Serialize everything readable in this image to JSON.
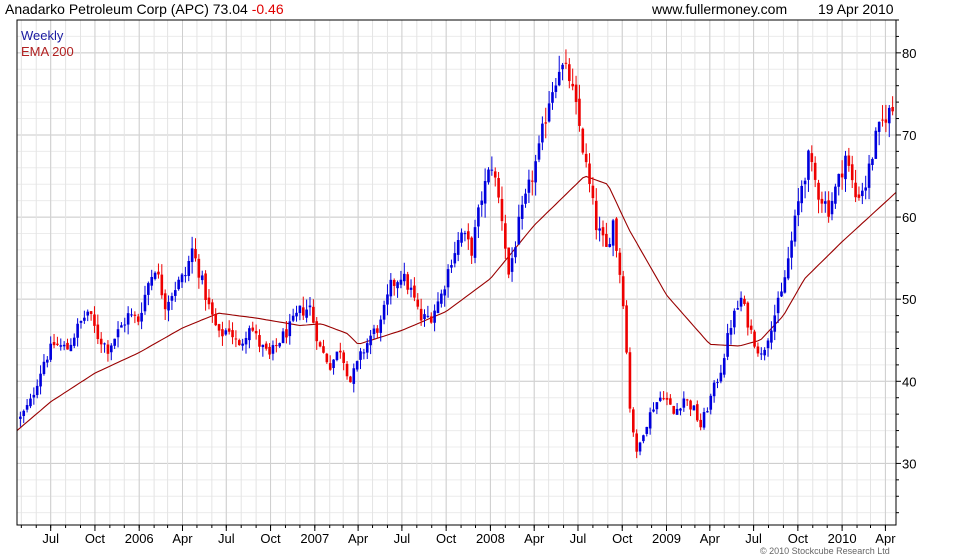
{
  "header": {
    "title": "Anadarko Petroleum Corp (APC)",
    "price": "73.04",
    "change": "-0.46",
    "site": "www.fullermoney.com",
    "date": "19 Apr 2010"
  },
  "footer": {
    "copyright": "© 2010 Stockcube Research Ltd"
  },
  "colors": {
    "up": "#0000dd",
    "down": "#ee0000",
    "ema": "#990000",
    "grid": "#d8d8d8",
    "axis": "#000000"
  },
  "chart_data": {
    "type": "candlestick",
    "legend": [
      {
        "label": "Weekly",
        "color": "#1a1aa0"
      },
      {
        "label": "EMA 200",
        "color": "#b02020"
      }
    ],
    "legend_position": "top-left",
    "grid": true,
    "y_axis_side": "right",
    "ylim": [
      22.5,
      84
    ],
    "yticks": [
      30,
      40,
      50,
      60,
      70,
      80
    ],
    "x_start": "2005-04-22",
    "x_end": "2010-04-23",
    "xticks": [
      {
        "label": "Jul",
        "date": "2005-07-01"
      },
      {
        "label": "Oct",
        "date": "2005-10-01"
      },
      {
        "label": "2006",
        "date": "2006-01-01"
      },
      {
        "label": "Apr",
        "date": "2006-04-01"
      },
      {
        "label": "Jul",
        "date": "2006-07-01"
      },
      {
        "label": "Oct",
        "date": "2006-10-01"
      },
      {
        "label": "2007",
        "date": "2007-01-01"
      },
      {
        "label": "Apr",
        "date": "2007-04-01"
      },
      {
        "label": "Jul",
        "date": "2007-07-01"
      },
      {
        "label": "Oct",
        "date": "2007-10-01"
      },
      {
        "label": "2008",
        "date": "2008-01-01"
      },
      {
        "label": "Apr",
        "date": "2008-04-01"
      },
      {
        "label": "Jul",
        "date": "2008-07-01"
      },
      {
        "label": "Oct",
        "date": "2008-10-01"
      },
      {
        "label": "2009",
        "date": "2009-01-01"
      },
      {
        "label": "Apr",
        "date": "2009-04-01"
      },
      {
        "label": "Jul",
        "date": "2009-07-01"
      },
      {
        "label": "Oct",
        "date": "2009-10-01"
      },
      {
        "label": "2010",
        "date": "2010-01-01"
      },
      {
        "label": "Apr",
        "date": "2010-04-01"
      }
    ],
    "close_anchors": [
      [
        "2005-04-29",
        35.5
      ],
      [
        "2005-05-20",
        37.5
      ],
      [
        "2005-06-17",
        42.5
      ],
      [
        "2005-07-08",
        44.5
      ],
      [
        "2005-08-05",
        44.0
      ],
      [
        "2005-08-26",
        46.5
      ],
      [
        "2005-09-16",
        48.5
      ],
      [
        "2005-10-07",
        45.5
      ],
      [
        "2005-10-28",
        44.0
      ],
      [
        "2005-11-18",
        46.0
      ],
      [
        "2005-12-09",
        48.0
      ],
      [
        "2005-12-30",
        47.5
      ],
      [
        "2006-01-20",
        52.0
      ],
      [
        "2006-02-03",
        54.0
      ],
      [
        "2006-02-24",
        49.5
      ],
      [
        "2006-03-17",
        51.5
      ],
      [
        "2006-04-07",
        53.0
      ],
      [
        "2006-04-21",
        56.0
      ],
      [
        "2006-05-05",
        53.5
      ],
      [
        "2006-05-26",
        49.0
      ],
      [
        "2006-06-16",
        45.5
      ],
      [
        "2006-07-07",
        46.5
      ],
      [
        "2006-07-28",
        44.0
      ],
      [
        "2006-08-18",
        47.0
      ],
      [
        "2006-09-08",
        44.5
      ],
      [
        "2006-09-29",
        43.0
      ],
      [
        "2006-10-20",
        45.0
      ],
      [
        "2006-11-10",
        46.5
      ],
      [
        "2006-12-01",
        48.5
      ],
      [
        "2006-12-22",
        49.0
      ],
      [
        "2007-01-12",
        44.0
      ],
      [
        "2007-02-02",
        42.0
      ],
      [
        "2007-02-23",
        44.0
      ],
      [
        "2007-03-16",
        40.0
      ],
      [
        "2007-04-06",
        43.0
      ],
      [
        "2007-04-27",
        45.5
      ],
      [
        "2007-05-18",
        47.0
      ],
      [
        "2007-06-08",
        51.5
      ],
      [
        "2007-06-29",
        53.0
      ],
      [
        "2007-07-20",
        51.0
      ],
      [
        "2007-08-10",
        47.5
      ],
      [
        "2007-08-31",
        48.0
      ],
      [
        "2007-09-21",
        50.5
      ],
      [
        "2007-10-12",
        55.0
      ],
      [
        "2007-11-02",
        58.0
      ],
      [
        "2007-11-23",
        56.0
      ],
      [
        "2007-12-14",
        62.5
      ],
      [
        "2008-01-04",
        66.5
      ],
      [
        "2008-01-25",
        60.0
      ],
      [
        "2008-02-08",
        53.0
      ],
      [
        "2008-02-29",
        59.0
      ],
      [
        "2008-03-21",
        63.5
      ],
      [
        "2008-04-11",
        68.0
      ],
      [
        "2008-05-02",
        74.5
      ],
      [
        "2008-05-23",
        78.5
      ],
      [
        "2008-06-13",
        77.0
      ],
      [
        "2008-07-04",
        71.0
      ],
      [
        "2008-07-18",
        66.0
      ],
      [
        "2008-08-08",
        59.0
      ],
      [
        "2008-08-29",
        56.0
      ],
      [
        "2008-09-12",
        59.5
      ],
      [
        "2008-10-03",
        50.0
      ],
      [
        "2008-10-17",
        37.0
      ],
      [
        "2008-10-31",
        31.0
      ],
      [
        "2008-11-14",
        34.0
      ],
      [
        "2008-12-05",
        37.0
      ],
      [
        "2008-12-26",
        38.5
      ],
      [
        "2009-01-16",
        36.0
      ],
      [
        "2009-02-06",
        38.0
      ],
      [
        "2009-02-27",
        36.5
      ],
      [
        "2009-03-13",
        34.5
      ],
      [
        "2009-04-03",
        38.0
      ],
      [
        "2009-04-24",
        41.5
      ],
      [
        "2009-05-15",
        47.0
      ],
      [
        "2009-06-05",
        50.0
      ],
      [
        "2009-06-26",
        46.0
      ],
      [
        "2009-07-17",
        43.0
      ],
      [
        "2009-08-07",
        47.0
      ],
      [
        "2009-08-28",
        50.5
      ],
      [
        "2009-09-18",
        57.0
      ],
      [
        "2009-10-09",
        64.0
      ],
      [
        "2009-10-23",
        67.0
      ],
      [
        "2009-11-13",
        63.0
      ],
      [
        "2009-12-04",
        61.0
      ],
      [
        "2009-12-25",
        64.5
      ],
      [
        "2010-01-08",
        67.5
      ],
      [
        "2010-01-29",
        62.5
      ],
      [
        "2010-02-19",
        64.0
      ],
      [
        "2010-03-12",
        69.5
      ],
      [
        "2010-04-02",
        72.5
      ],
      [
        "2010-04-16",
        73.0
      ]
    ],
    "ema_anchors": [
      [
        "2005-04-22",
        34.0
      ],
      [
        "2005-07-01",
        37.5
      ],
      [
        "2005-10-01",
        41.0
      ],
      [
        "2006-01-01",
        43.5
      ],
      [
        "2006-04-01",
        46.5
      ],
      [
        "2006-06-15",
        48.3
      ],
      [
        "2006-09-01",
        47.7
      ],
      [
        "2006-12-01",
        46.8
      ],
      [
        "2007-01-15",
        47.0
      ],
      [
        "2007-03-10",
        45.8
      ],
      [
        "2007-04-01",
        44.5
      ],
      [
        "2007-07-01",
        46.2
      ],
      [
        "2007-10-01",
        48.5
      ],
      [
        "2008-01-01",
        52.5
      ],
      [
        "2008-04-01",
        59.0
      ],
      [
        "2008-07-15",
        65.0
      ],
      [
        "2008-09-01",
        64.0
      ],
      [
        "2008-10-15",
        58.5
      ],
      [
        "2009-01-01",
        50.5
      ],
      [
        "2009-04-01",
        44.5
      ],
      [
        "2009-06-01",
        44.3
      ],
      [
        "2009-07-15",
        45.0
      ],
      [
        "2009-09-01",
        48.0
      ],
      [
        "2009-10-15",
        52.5
      ],
      [
        "2010-01-01",
        57.0
      ],
      [
        "2010-04-23",
        63.0
      ]
    ]
  }
}
